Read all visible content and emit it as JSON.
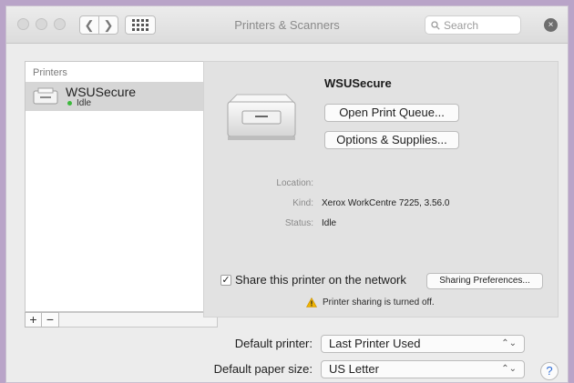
{
  "window": {
    "title": "Printers & Scanners",
    "search_placeholder": "Search",
    "back_glyph": "❮",
    "forward_glyph": "❯",
    "clear_glyph": "×"
  },
  "sidebar": {
    "header": "Printers",
    "printers": [
      {
        "name": "WSUSecure",
        "status": "Idle",
        "status_color": "#3cb83c"
      }
    ],
    "add_label": "+",
    "remove_label": "−"
  },
  "detail": {
    "printer_name": "WSUSecure",
    "open_queue_label": "Open Print Queue...",
    "options_label": "Options & Supplies...",
    "location_label": "Location:",
    "location_value": "",
    "kind_label": "Kind:",
    "kind_value": "Xerox WorkCentre 7225, 3.56.0",
    "status_label": "Status:",
    "status_value": "Idle",
    "share_checked": true,
    "share_check_glyph": "✓",
    "share_label": "Share this printer on the network",
    "sharing_prefs_label": "Sharing Preferences...",
    "warning_text": "Printer sharing is turned off."
  },
  "defaults": {
    "default_printer_label": "Default printer:",
    "default_printer_value": "Last Printer Used",
    "paper_size_label": "Default paper size:",
    "paper_size_value": "US Letter",
    "help_glyph": "?",
    "select_arrow_glyph": "⌃⌄"
  },
  "icons": {
    "traffic_lights": [
      "close-icon",
      "minimize-icon",
      "zoom-icon"
    ],
    "grid": "grid-icon",
    "search": "search-icon",
    "warning": "warning-icon",
    "printer": "printer-icon"
  }
}
